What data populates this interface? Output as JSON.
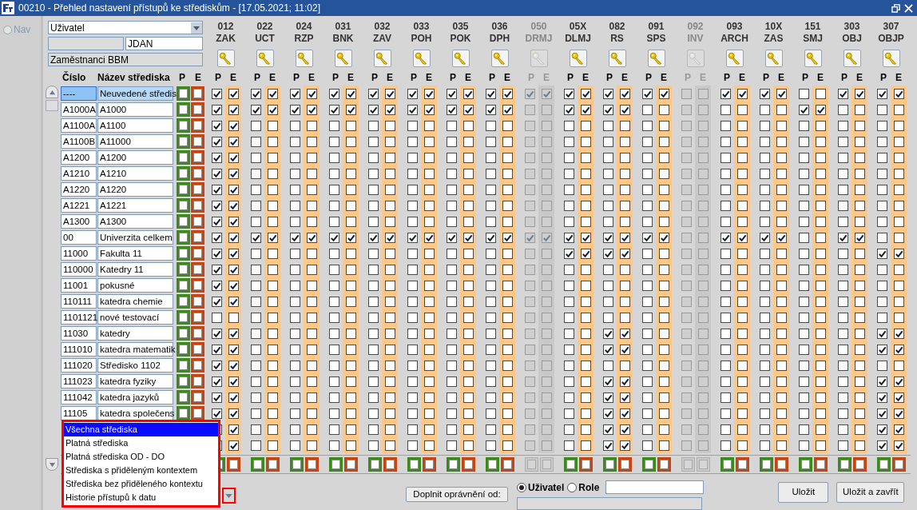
{
  "window": {
    "title": "00210 - Přehled nastavení přístupů ke střediskům - [17.05.2021; 11:02]",
    "nav_label": "Nav",
    "nav_selected": false
  },
  "filter": {
    "type_value": "Uživatel",
    "user_id": "JDAN",
    "group": "Zaměstnanci BBM"
  },
  "headers": {
    "code": "Číslo",
    "name": "Název střediska",
    "p": "P",
    "e": "E"
  },
  "columns": [
    {
      "code": "012",
      "abbr": "ZAK",
      "enabled": true,
      "p": "P",
      "e": "E"
    },
    {
      "code": "022",
      "abbr": "UCT",
      "enabled": true,
      "p": "P",
      "e": "E"
    },
    {
      "code": "024",
      "abbr": "RZP",
      "enabled": true,
      "p": "P",
      "e": "E"
    },
    {
      "code": "031",
      "abbr": "BNK",
      "enabled": true,
      "p": "P",
      "e": "E"
    },
    {
      "code": "032",
      "abbr": "ZAV",
      "enabled": true,
      "p": "P",
      "e": "E"
    },
    {
      "code": "033",
      "abbr": "POH",
      "enabled": true,
      "p": "P",
      "e": "E"
    },
    {
      "code": "035",
      "abbr": "POK",
      "enabled": true,
      "p": "P",
      "e": "E"
    },
    {
      "code": "036",
      "abbr": "DPH",
      "enabled": true,
      "p": "P",
      "e": "E"
    },
    {
      "code": "050",
      "abbr": "DRMJ",
      "enabled": false,
      "p": "P",
      "e": "E"
    },
    {
      "code": "05X",
      "abbr": "DLMJ",
      "enabled": true,
      "p": "P",
      "e": "E"
    },
    {
      "code": "082",
      "abbr": "RS",
      "enabled": true,
      "p": "P",
      "e": "E"
    },
    {
      "code": "091",
      "abbr": "SPS",
      "enabled": true,
      "p": "P",
      "e": "E"
    },
    {
      "code": "092",
      "abbr": "INV",
      "enabled": false,
      "p": "P",
      "e": "E"
    },
    {
      "code": "093",
      "abbr": "ARCH",
      "enabled": true,
      "p": "P",
      "e": "E"
    },
    {
      "code": "10X",
      "abbr": "ZAS",
      "enabled": true,
      "p": "P",
      "e": "E"
    },
    {
      "code": "151",
      "abbr": "SMJ",
      "enabled": true,
      "p": "P",
      "e": "E"
    },
    {
      "code": "303",
      "abbr": "OBJ",
      "enabled": true,
      "p": "P",
      "e": "E"
    },
    {
      "code": "307",
      "abbr": "OBJP",
      "enabled": true,
      "p": "P",
      "e": "E"
    }
  ],
  "rows": [
    {
      "code": "----",
      "name": "Neuvedené středis",
      "selected": true,
      "cells": [
        [
          true,
          true
        ],
        [
          true,
          true
        ],
        [
          true,
          true
        ],
        [
          true,
          true
        ],
        [
          true,
          true
        ],
        [
          true,
          true
        ],
        [
          true,
          true
        ],
        [
          true,
          true
        ],
        [
          true,
          true
        ],
        [
          true,
          true
        ],
        [
          true,
          true
        ],
        [
          true,
          true
        ],
        [
          false,
          false
        ],
        [
          true,
          true
        ],
        [
          true,
          true
        ],
        [
          false,
          false
        ],
        [
          true,
          true
        ],
        [
          true,
          true
        ]
      ]
    },
    {
      "code": "A1000A",
      "name": "A1000",
      "selected": false,
      "cells": [
        [
          true,
          true
        ],
        [
          true,
          true
        ],
        [
          true,
          true
        ],
        [
          true,
          true
        ],
        [
          true,
          true
        ],
        [
          true,
          true
        ],
        [
          true,
          true
        ],
        [
          true,
          true
        ],
        [
          false,
          false
        ],
        [
          true,
          true
        ],
        [
          true,
          true
        ],
        [
          false,
          false
        ],
        [
          false,
          false
        ],
        [
          false,
          false
        ],
        [
          false,
          false
        ],
        [
          true,
          true
        ],
        [
          false,
          false
        ],
        [
          false,
          false
        ]
      ]
    },
    {
      "code": "A1100A",
      "name": "A1100",
      "selected": false,
      "cells": [
        [
          true,
          true
        ],
        [
          false,
          false
        ],
        [
          false,
          false
        ],
        [
          false,
          false
        ],
        [
          false,
          false
        ],
        [
          false,
          false
        ],
        [
          false,
          false
        ],
        [
          false,
          false
        ],
        [
          false,
          false
        ],
        [
          false,
          false
        ],
        [
          false,
          false
        ],
        [
          false,
          false
        ],
        [
          false,
          false
        ],
        [
          false,
          false
        ],
        [
          false,
          false
        ],
        [
          false,
          false
        ],
        [
          false,
          false
        ],
        [
          false,
          false
        ]
      ]
    },
    {
      "code": "A1100B",
      "name": "A11000",
      "selected": false,
      "cells": [
        [
          true,
          true
        ],
        [
          false,
          false
        ],
        [
          false,
          false
        ],
        [
          false,
          false
        ],
        [
          false,
          false
        ],
        [
          false,
          false
        ],
        [
          false,
          false
        ],
        [
          false,
          false
        ],
        [
          false,
          false
        ],
        [
          false,
          false
        ],
        [
          false,
          false
        ],
        [
          false,
          false
        ],
        [
          false,
          false
        ],
        [
          false,
          false
        ],
        [
          false,
          false
        ],
        [
          false,
          false
        ],
        [
          false,
          false
        ],
        [
          false,
          false
        ]
      ]
    },
    {
      "code": "A1200",
      "name": "A1200",
      "selected": false,
      "cells": [
        [
          true,
          true
        ],
        [
          false,
          false
        ],
        [
          false,
          false
        ],
        [
          false,
          false
        ],
        [
          false,
          false
        ],
        [
          false,
          false
        ],
        [
          false,
          false
        ],
        [
          false,
          false
        ],
        [
          false,
          false
        ],
        [
          false,
          false
        ],
        [
          false,
          false
        ],
        [
          false,
          false
        ],
        [
          false,
          false
        ],
        [
          false,
          false
        ],
        [
          false,
          false
        ],
        [
          false,
          false
        ],
        [
          false,
          false
        ],
        [
          false,
          false
        ]
      ]
    },
    {
      "code": "A1210",
      "name": "A1210",
      "selected": false,
      "cells": [
        [
          true,
          true
        ],
        [
          false,
          false
        ],
        [
          false,
          false
        ],
        [
          false,
          false
        ],
        [
          false,
          false
        ],
        [
          false,
          false
        ],
        [
          false,
          false
        ],
        [
          false,
          false
        ],
        [
          false,
          false
        ],
        [
          false,
          false
        ],
        [
          false,
          false
        ],
        [
          false,
          false
        ],
        [
          false,
          false
        ],
        [
          false,
          false
        ],
        [
          false,
          false
        ],
        [
          false,
          false
        ],
        [
          false,
          false
        ],
        [
          false,
          false
        ]
      ]
    },
    {
      "code": "A1220",
      "name": "A1220",
      "selected": false,
      "cells": [
        [
          true,
          true
        ],
        [
          false,
          false
        ],
        [
          false,
          false
        ],
        [
          false,
          false
        ],
        [
          false,
          false
        ],
        [
          false,
          false
        ],
        [
          false,
          false
        ],
        [
          false,
          false
        ],
        [
          false,
          false
        ],
        [
          false,
          false
        ],
        [
          false,
          false
        ],
        [
          false,
          false
        ],
        [
          false,
          false
        ],
        [
          false,
          false
        ],
        [
          false,
          false
        ],
        [
          false,
          false
        ],
        [
          false,
          false
        ],
        [
          false,
          false
        ]
      ]
    },
    {
      "code": "A1221",
      "name": "A1221",
      "selected": false,
      "cells": [
        [
          true,
          true
        ],
        [
          false,
          false
        ],
        [
          false,
          false
        ],
        [
          false,
          false
        ],
        [
          false,
          false
        ],
        [
          false,
          false
        ],
        [
          false,
          false
        ],
        [
          false,
          false
        ],
        [
          false,
          false
        ],
        [
          false,
          false
        ],
        [
          false,
          false
        ],
        [
          false,
          false
        ],
        [
          false,
          false
        ],
        [
          false,
          false
        ],
        [
          false,
          false
        ],
        [
          false,
          false
        ],
        [
          false,
          false
        ],
        [
          false,
          false
        ]
      ]
    },
    {
      "code": "A1300",
      "name": "A1300",
      "selected": false,
      "cells": [
        [
          true,
          true
        ],
        [
          false,
          false
        ],
        [
          false,
          false
        ],
        [
          false,
          false
        ],
        [
          false,
          false
        ],
        [
          false,
          false
        ],
        [
          false,
          false
        ],
        [
          false,
          false
        ],
        [
          false,
          false
        ],
        [
          false,
          false
        ],
        [
          false,
          false
        ],
        [
          false,
          false
        ],
        [
          false,
          false
        ],
        [
          false,
          false
        ],
        [
          false,
          false
        ],
        [
          false,
          false
        ],
        [
          false,
          false
        ],
        [
          false,
          false
        ]
      ]
    },
    {
      "code": "00",
      "name": "Univerzita celkem",
      "selected": false,
      "cells": [
        [
          true,
          true
        ],
        [
          true,
          true
        ],
        [
          true,
          true
        ],
        [
          true,
          true
        ],
        [
          true,
          true
        ],
        [
          true,
          true
        ],
        [
          true,
          true
        ],
        [
          true,
          true
        ],
        [
          true,
          true
        ],
        [
          true,
          true
        ],
        [
          true,
          true
        ],
        [
          true,
          true
        ],
        [
          false,
          false
        ],
        [
          true,
          true
        ],
        [
          true,
          true
        ],
        [
          false,
          false
        ],
        [
          true,
          true
        ],
        [
          false,
          false
        ]
      ]
    },
    {
      "code": "11000",
      "name": "Fakulta 11",
      "selected": false,
      "cells": [
        [
          true,
          true
        ],
        [
          false,
          false
        ],
        [
          false,
          false
        ],
        [
          false,
          false
        ],
        [
          false,
          false
        ],
        [
          false,
          false
        ],
        [
          false,
          false
        ],
        [
          false,
          false
        ],
        [
          false,
          false
        ],
        [
          true,
          true
        ],
        [
          true,
          true
        ],
        [
          false,
          false
        ],
        [
          false,
          false
        ],
        [
          false,
          false
        ],
        [
          false,
          false
        ],
        [
          false,
          false
        ],
        [
          false,
          false
        ],
        [
          true,
          true
        ]
      ]
    },
    {
      "code": "110000",
      "name": "Katedry 11",
      "selected": false,
      "cells": [
        [
          true,
          true
        ],
        [
          false,
          false
        ],
        [
          false,
          false
        ],
        [
          false,
          false
        ],
        [
          false,
          false
        ],
        [
          false,
          false
        ],
        [
          false,
          false
        ],
        [
          false,
          false
        ],
        [
          false,
          false
        ],
        [
          false,
          false
        ],
        [
          false,
          false
        ],
        [
          false,
          false
        ],
        [
          false,
          false
        ],
        [
          false,
          false
        ],
        [
          false,
          false
        ],
        [
          false,
          false
        ],
        [
          false,
          false
        ],
        [
          false,
          false
        ]
      ]
    },
    {
      "code": "11001",
      "name": "pokusné",
      "selected": false,
      "cells": [
        [
          true,
          true
        ],
        [
          false,
          false
        ],
        [
          false,
          false
        ],
        [
          false,
          false
        ],
        [
          false,
          false
        ],
        [
          false,
          false
        ],
        [
          false,
          false
        ],
        [
          false,
          false
        ],
        [
          false,
          false
        ],
        [
          false,
          false
        ],
        [
          false,
          false
        ],
        [
          false,
          false
        ],
        [
          false,
          false
        ],
        [
          false,
          false
        ],
        [
          false,
          false
        ],
        [
          false,
          false
        ],
        [
          false,
          false
        ],
        [
          false,
          false
        ]
      ]
    },
    {
      "code": "110111",
      "name": "katedra chemie",
      "selected": false,
      "cells": [
        [
          true,
          true
        ],
        [
          false,
          false
        ],
        [
          false,
          false
        ],
        [
          false,
          false
        ],
        [
          false,
          false
        ],
        [
          false,
          false
        ],
        [
          false,
          false
        ],
        [
          false,
          false
        ],
        [
          false,
          false
        ],
        [
          false,
          false
        ],
        [
          false,
          false
        ],
        [
          false,
          false
        ],
        [
          false,
          false
        ],
        [
          false,
          false
        ],
        [
          false,
          false
        ],
        [
          false,
          false
        ],
        [
          false,
          false
        ],
        [
          false,
          false
        ]
      ]
    },
    {
      "code": "1101121",
      "name": "nové testovací",
      "selected": false,
      "cells": [
        [
          false,
          false
        ],
        [
          false,
          false
        ],
        [
          false,
          false
        ],
        [
          false,
          false
        ],
        [
          false,
          false
        ],
        [
          false,
          false
        ],
        [
          false,
          false
        ],
        [
          false,
          false
        ],
        [
          false,
          false
        ],
        [
          false,
          false
        ],
        [
          false,
          false
        ],
        [
          false,
          false
        ],
        [
          false,
          false
        ],
        [
          false,
          false
        ],
        [
          false,
          false
        ],
        [
          false,
          false
        ],
        [
          false,
          false
        ],
        [
          false,
          false
        ]
      ]
    },
    {
      "code": "11030",
      "name": "katedry",
      "selected": false,
      "cells": [
        [
          true,
          true
        ],
        [
          false,
          false
        ],
        [
          false,
          false
        ],
        [
          false,
          false
        ],
        [
          false,
          false
        ],
        [
          false,
          false
        ],
        [
          false,
          false
        ],
        [
          false,
          false
        ],
        [
          false,
          false
        ],
        [
          false,
          false
        ],
        [
          true,
          true
        ],
        [
          false,
          false
        ],
        [
          false,
          false
        ],
        [
          false,
          false
        ],
        [
          false,
          false
        ],
        [
          false,
          false
        ],
        [
          false,
          false
        ],
        [
          true,
          true
        ]
      ]
    },
    {
      "code": "111010",
      "name": "katedra matematik",
      "selected": false,
      "cells": [
        [
          true,
          true
        ],
        [
          false,
          false
        ],
        [
          false,
          false
        ],
        [
          false,
          false
        ],
        [
          false,
          false
        ],
        [
          false,
          false
        ],
        [
          false,
          false
        ],
        [
          false,
          false
        ],
        [
          false,
          false
        ],
        [
          false,
          false
        ],
        [
          true,
          true
        ],
        [
          false,
          false
        ],
        [
          false,
          false
        ],
        [
          false,
          false
        ],
        [
          false,
          false
        ],
        [
          false,
          false
        ],
        [
          false,
          false
        ],
        [
          true,
          true
        ]
      ]
    },
    {
      "code": "111020",
      "name": "Středisko 1102",
      "selected": false,
      "cells": [
        [
          true,
          true
        ],
        [
          false,
          false
        ],
        [
          false,
          false
        ],
        [
          false,
          false
        ],
        [
          false,
          false
        ],
        [
          false,
          false
        ],
        [
          false,
          false
        ],
        [
          false,
          false
        ],
        [
          false,
          false
        ],
        [
          false,
          false
        ],
        [
          false,
          false
        ],
        [
          false,
          false
        ],
        [
          false,
          false
        ],
        [
          false,
          false
        ],
        [
          false,
          false
        ],
        [
          false,
          false
        ],
        [
          false,
          false
        ],
        [
          false,
          false
        ]
      ]
    },
    {
      "code": "111023",
      "name": "katedra fyziky",
      "selected": false,
      "cells": [
        [
          true,
          true
        ],
        [
          false,
          false
        ],
        [
          false,
          false
        ],
        [
          false,
          false
        ],
        [
          false,
          false
        ],
        [
          false,
          false
        ],
        [
          false,
          false
        ],
        [
          false,
          false
        ],
        [
          false,
          false
        ],
        [
          false,
          false
        ],
        [
          true,
          true
        ],
        [
          false,
          false
        ],
        [
          false,
          false
        ],
        [
          false,
          false
        ],
        [
          false,
          false
        ],
        [
          false,
          false
        ],
        [
          false,
          false
        ],
        [
          true,
          true
        ]
      ]
    },
    {
      "code": "111042",
      "name": "katedra jazyků",
      "selected": false,
      "cells": [
        [
          true,
          true
        ],
        [
          false,
          false
        ],
        [
          false,
          false
        ],
        [
          false,
          false
        ],
        [
          false,
          false
        ],
        [
          false,
          false
        ],
        [
          false,
          false
        ],
        [
          false,
          false
        ],
        [
          false,
          false
        ],
        [
          false,
          false
        ],
        [
          true,
          true
        ],
        [
          false,
          false
        ],
        [
          false,
          false
        ],
        [
          false,
          false
        ],
        [
          false,
          false
        ],
        [
          false,
          false
        ],
        [
          false,
          false
        ],
        [
          true,
          true
        ]
      ]
    },
    {
      "code": "11105",
      "name": "katedra společens",
      "selected": false,
      "cells": [
        [
          true,
          true
        ],
        [
          false,
          false
        ],
        [
          false,
          false
        ],
        [
          false,
          false
        ],
        [
          false,
          false
        ],
        [
          false,
          false
        ],
        [
          false,
          false
        ],
        [
          false,
          false
        ],
        [
          false,
          false
        ],
        [
          false,
          false
        ],
        [
          true,
          true
        ],
        [
          false,
          false
        ],
        [
          false,
          false
        ],
        [
          false,
          false
        ],
        [
          false,
          false
        ],
        [
          false,
          false
        ],
        [
          false,
          false
        ],
        [
          true,
          true
        ]
      ]
    },
    {
      "cells": [
        [
          true,
          true
        ],
        [
          false,
          false
        ],
        [
          false,
          false
        ],
        [
          false,
          false
        ],
        [
          false,
          false
        ],
        [
          false,
          false
        ],
        [
          false,
          false
        ],
        [
          false,
          false
        ],
        [
          false,
          false
        ],
        [
          false,
          false
        ],
        [
          true,
          true
        ],
        [
          false,
          false
        ],
        [
          false,
          false
        ],
        [
          false,
          false
        ],
        [
          false,
          false
        ],
        [
          false,
          false
        ],
        [
          false,
          false
        ],
        [
          true,
          true
        ]
      ]
    },
    {
      "cells": [
        [
          true,
          true
        ],
        [
          false,
          false
        ],
        [
          false,
          false
        ],
        [
          false,
          false
        ],
        [
          false,
          false
        ],
        [
          false,
          false
        ],
        [
          false,
          false
        ],
        [
          false,
          false
        ],
        [
          false,
          false
        ],
        [
          false,
          false
        ],
        [
          true,
          true
        ],
        [
          false,
          false
        ],
        [
          false,
          false
        ],
        [
          false,
          false
        ],
        [
          false,
          false
        ],
        [
          false,
          false
        ],
        [
          false,
          false
        ],
        [
          true,
          true
        ]
      ]
    }
  ],
  "filter_menu": {
    "options": [
      {
        "label": "Všechna střediska",
        "selected": true
      },
      {
        "label": "Platná střediska",
        "selected": false
      },
      {
        "label": "Platná střediska OD - DO",
        "selected": false
      },
      {
        "label": "Střediska s přiděleným kontextem",
        "selected": false
      },
      {
        "label": "Střediska bez přiděleného kontextu",
        "selected": false
      },
      {
        "label": "Historie přístupů k datu",
        "selected": false
      }
    ]
  },
  "fill_button": "Doplnit oprávnění od:",
  "source": [
    {
      "label": "Uživatel",
      "selected": true
    },
    {
      "label": "Role",
      "selected": false
    }
  ],
  "buttons": [
    "Uložit",
    "Uložit a zavřít"
  ]
}
